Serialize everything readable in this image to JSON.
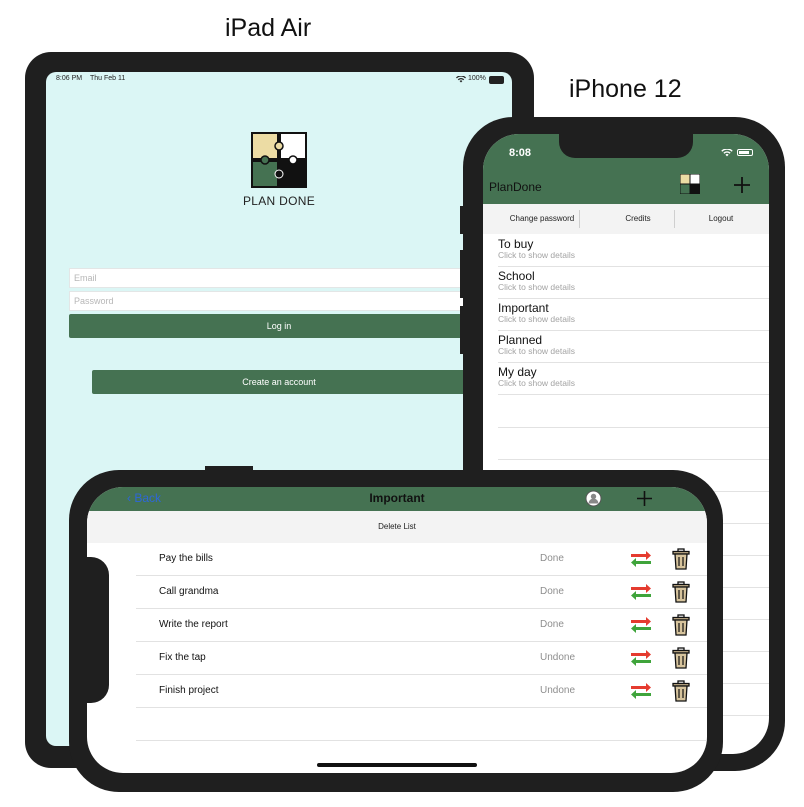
{
  "labels": {
    "ipad": "iPad Air",
    "iphone": "iPhone 12"
  },
  "ipad": {
    "status_time": "8:06 PM",
    "status_date": "Thu Feb 11",
    "status_battery": "100%",
    "app_name": "PLAN DONE",
    "email_placeholder": "Email",
    "password_placeholder": "Password",
    "login_label": "Log in",
    "create_account_label": "Create an account"
  },
  "iphone": {
    "time": "8:08",
    "nav_title": "PlanDone",
    "toolbar": {
      "change_password": "Change password",
      "credits": "Credits",
      "logout": "Logout"
    },
    "lists": [
      {
        "title": "To buy",
        "subtitle": "Click to show details"
      },
      {
        "title": "School",
        "subtitle": "Click to show details"
      },
      {
        "title": "Important",
        "subtitle": "Click to show details"
      },
      {
        "title": "Planned",
        "subtitle": "Click to show details"
      },
      {
        "title": "My day",
        "subtitle": "Click to show details"
      }
    ]
  },
  "landscape": {
    "back_label": "Back",
    "title": "Important",
    "delete_list_label": "Delete List",
    "tasks": [
      {
        "title": "Pay the bills",
        "status": "Done"
      },
      {
        "title": "Call grandma",
        "status": "Done"
      },
      {
        "title": "Write the report",
        "status": "Done"
      },
      {
        "title": "Fix the tap",
        "status": "Undone"
      },
      {
        "title": "Finish project",
        "status": "Undone"
      }
    ]
  },
  "colors": {
    "brand_green": "#457252",
    "ipad_bg": "#dbf6f5",
    "device_frame": "#1f1f1f",
    "back_blue": "#2d67d8"
  },
  "icons": {
    "status_wifi": "wifi-icon",
    "add": "plus-icon",
    "profile": "profile-icon",
    "swap": "swap-arrows-icon",
    "delete": "trash-icon",
    "logo": "puzzle-logo-icon"
  }
}
